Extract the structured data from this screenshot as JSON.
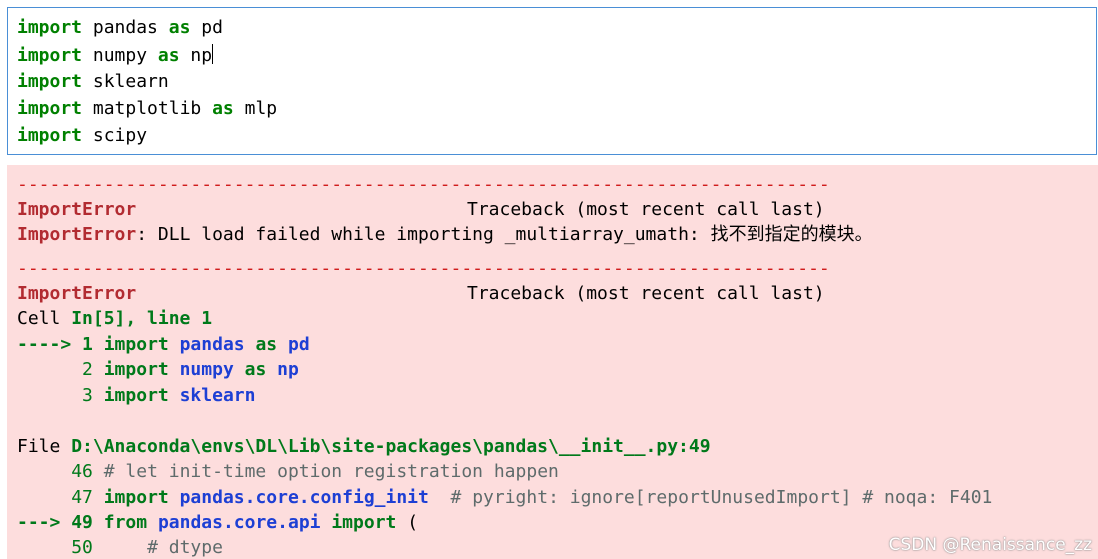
{
  "input_cell": {
    "lines": [
      {
        "kw": "import",
        "rest": " pandas ",
        "kw2": "as",
        "rest2": " pd"
      },
      {
        "kw": "import",
        "rest": " numpy ",
        "kw2": "as",
        "rest2": " np"
      },
      {
        "kw": "import",
        "rest": " sklearn"
      },
      {
        "kw": "import",
        "rest": " matplotlib ",
        "kw2": "as",
        "rest2": " mlp"
      },
      {
        "kw": "import",
        "rest": " scipy"
      }
    ]
  },
  "output": {
    "separator": "---------------------------------------------------------------------------",
    "tb1": {
      "error_name": "ImportError",
      "traceback_header": "Traceback (most recent call last)",
      "message_rest": ": DLL load failed while importing _multiarray_umath: 找不到指定的模块。"
    },
    "tb2": {
      "error_name": "ImportError",
      "traceback_header": "Traceback (most recent call last)",
      "cell_label": "Cell ",
      "cell_ref": "In[5], line 1",
      "frame1": [
        {
          "arrow": "---->",
          "num": "1",
          "kw": "import",
          "mod": "pandas",
          "as": "as",
          "alias": "pd"
        },
        {
          "arrow": "",
          "num": "2",
          "kw": "import",
          "mod": "numpy",
          "as": "as",
          "alias": "np"
        },
        {
          "arrow": "",
          "num": "3",
          "kw": "import",
          "mod": "sklearn"
        }
      ],
      "file_label": "File ",
      "file_path": "D:\\Anaconda\\envs\\DL\\Lib\\site-packages\\pandas\\__init__.py:49",
      "frame2": {
        "l46_num": "46",
        "l46_text": "# let init-time option registration happen",
        "l47_num": "47",
        "l47_kw": "import",
        "l47_mod": "pandas.core.config_init",
        "l47_comment": "# pyright: ignore[reportUnusedImport] # noqa: F401",
        "l49_arrow": "--->",
        "l49_num": "49",
        "l49_from": "from",
        "l49_mod": "pandas.core.api",
        "l49_kw": "import",
        "l49_rest": " (",
        "l50_num": "50",
        "l50_text": "# dtype"
      }
    }
  },
  "watermark": "CSDN @Renaissance_zz"
}
